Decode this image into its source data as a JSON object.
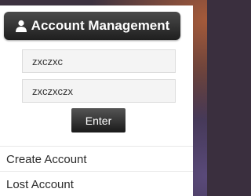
{
  "panel": {
    "title": "Account Management",
    "title_icon": "user-icon"
  },
  "form": {
    "username_value": "zxczxc",
    "password_value": "zxczxczx",
    "enter_label": "Enter"
  },
  "links": {
    "create_account": "Create Account",
    "lost_account": "Lost Account"
  },
  "colors": {
    "header_dark": "#1f1f1f",
    "button_dark": "#1a1a1a",
    "panel_bg": "#ffffff",
    "field_bg": "#f4f4f4"
  }
}
